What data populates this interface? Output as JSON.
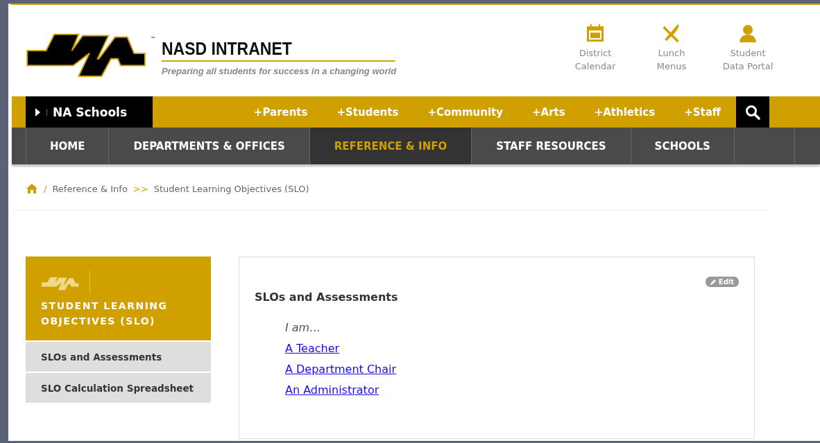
{
  "site": {
    "logo_mark": "™",
    "title": "NASD INTRANET",
    "tagline": "Preparing all students for success in a changing world"
  },
  "quick_links": [
    {
      "kind": "calendar",
      "lines": [
        "District",
        "Calendar"
      ]
    },
    {
      "kind": "utensils",
      "lines": [
        "Lunch",
        "Menus"
      ]
    },
    {
      "kind": "person",
      "lines": [
        "Student",
        "Data Portal"
      ]
    }
  ],
  "schools_menu": {
    "label": "NA Schools"
  },
  "utility_links": [
    {
      "label": "+Parents"
    },
    {
      "label": "+Students"
    },
    {
      "label": "+Community"
    },
    {
      "label": "+Arts"
    },
    {
      "label": "+Athletics"
    },
    {
      "label": "+Staff"
    }
  ],
  "nav": [
    {
      "label": "HOME",
      "selected": false
    },
    {
      "label": "DEPARTMENTS & OFFICES",
      "selected": false
    },
    {
      "label": "REFERENCE & INFO",
      "selected": true
    },
    {
      "label": "STAFF RESOURCES",
      "selected": false
    },
    {
      "label": "SCHOOLS",
      "selected": false
    }
  ],
  "breadcrumb": [
    {
      "separator": "/",
      "label": "Reference & Info"
    },
    {
      "separator": ">>",
      "label": "Student Learning Objectives (SLO)"
    }
  ],
  "sidebar": {
    "title": "STUDENT LEARNING OBJECTIVES (SLO)",
    "items": [
      {
        "label": "SLOs and Assessments"
      },
      {
        "label": "SLO Calculation Spreadsheet"
      }
    ]
  },
  "content": {
    "heading": "SLOs and Assessments",
    "edit_button": "Edit",
    "intro": "I am…",
    "links": [
      {
        "label": "A Teacher"
      },
      {
        "label": "A Department Chair"
      },
      {
        "label": "An Administrator"
      }
    ]
  }
}
